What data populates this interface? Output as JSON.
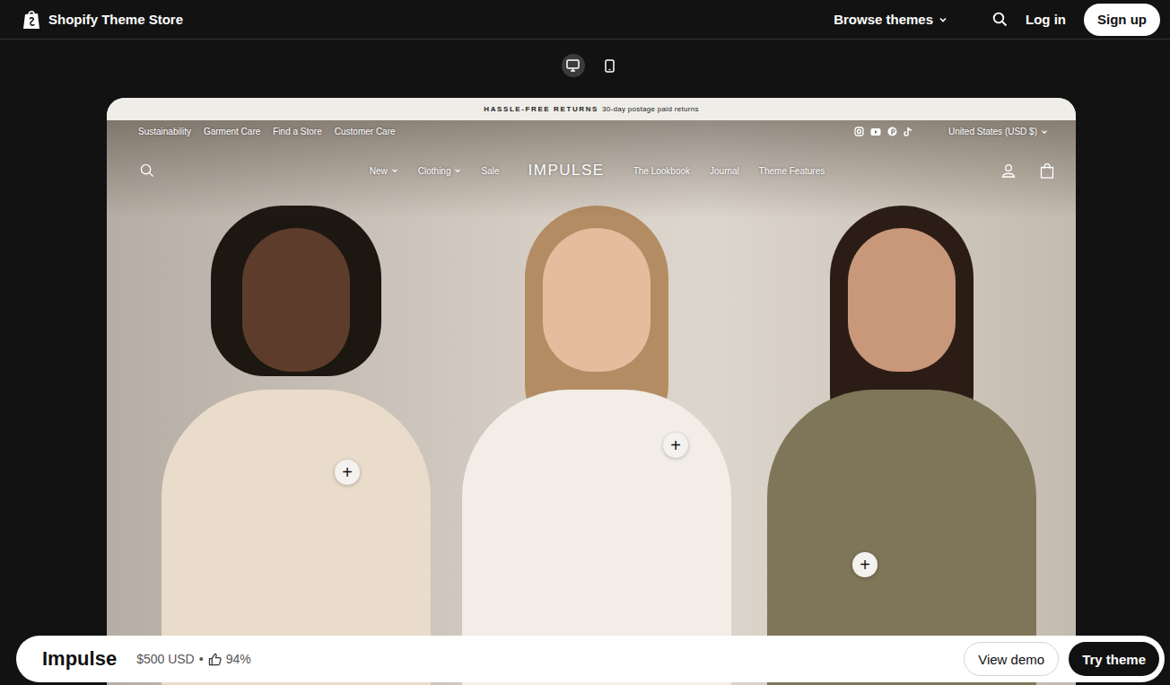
{
  "header": {
    "brand": "Shopify Theme Store",
    "browse": "Browse themes",
    "login": "Log in",
    "signup": "Sign up"
  },
  "device_toggle": [
    {
      "kind": "desktop",
      "selected": true
    },
    {
      "kind": "mobile",
      "selected": false
    }
  ],
  "preview": {
    "announcement": {
      "bold": "HASSLE-FREE RETURNS",
      "text": "30-day postage paid returns"
    },
    "utility_links": [
      "Sustainability",
      "Garment Care",
      "Find a Store",
      "Customer Care"
    ],
    "social": [
      {
        "kind": "instagram"
      },
      {
        "kind": "youtube"
      },
      {
        "kind": "pinterest"
      },
      {
        "kind": "tiktok"
      }
    ],
    "currency": "United States (USD $)",
    "logo": "IMPULSE",
    "nav_left": [
      {
        "label": "New",
        "dropdown": true
      },
      {
        "label": "Clothing",
        "dropdown": true
      },
      {
        "label": "Sale",
        "dropdown": false
      }
    ],
    "nav_right": [
      {
        "label": "The Lookbook",
        "dropdown": false
      },
      {
        "label": "Journal",
        "dropdown": false
      },
      {
        "label": "Theme Features",
        "dropdown": false
      }
    ],
    "hotspots": [
      "+",
      "+",
      "+"
    ]
  },
  "theme_bar": {
    "name": "Impulse",
    "price": "$500 USD",
    "separator": "•",
    "rating": "94%",
    "view_demo": "View demo",
    "try_theme": "Try theme"
  }
}
